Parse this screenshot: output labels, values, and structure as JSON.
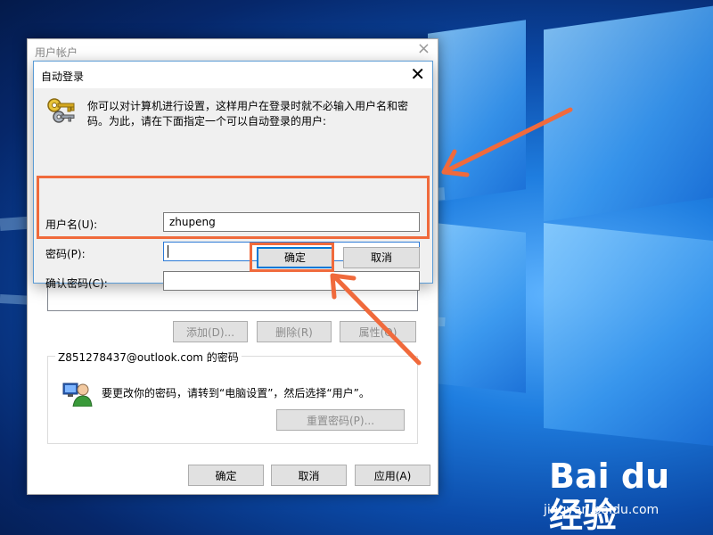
{
  "outer_window": {
    "title": "用户帐户",
    "close_glyph": "×",
    "buttons": {
      "add": "添加(D)...",
      "remove": "删除(R)",
      "properties": "属性(O)"
    },
    "password_group": {
      "title": "Z851278437@outlook.com 的密码",
      "message": "要更改你的密码，请转到“电脑设置”，然后选择“用户”。",
      "reset_button": "重置密码(P)..."
    },
    "footer": {
      "ok": "确定",
      "cancel": "取消",
      "apply": "应用(A)"
    }
  },
  "dialog": {
    "title": "自动登录",
    "close_glyph": "✕",
    "description": "你可以对计算机进行设置，这样用户在登录时就不必输入用户名和密码。为此，请在下面指定一个可以自动登录的用户:",
    "username_label": "用户名(U):",
    "username_value": "zhupeng",
    "password_label": "密码(P):",
    "password_value": "",
    "confirm_label": "确认密码(C):",
    "confirm_value": "",
    "ok_label": "确定",
    "cancel_label": "取消"
  },
  "icons": {
    "dialog": "key-icon",
    "user": "user-icon"
  },
  "colors": {
    "accent": "#0078d7",
    "annotation": "#f06a3c"
  },
  "watermark": {
    "logo": "Bai du 经验",
    "url": "jingyan.baidu.com"
  }
}
